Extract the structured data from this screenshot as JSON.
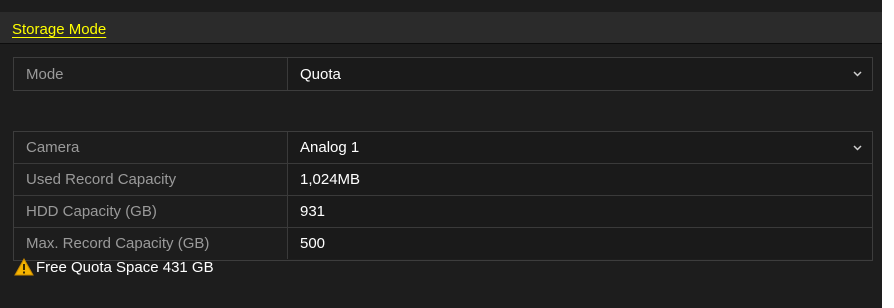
{
  "tab": {
    "label": "Storage Mode"
  },
  "mode": {
    "label": "Mode",
    "value": "Quota"
  },
  "camera_settings": {
    "camera": {
      "label": "Camera",
      "value": "Analog 1"
    },
    "used_record_capacity": {
      "label": "Used Record Capacity",
      "value": "1,024MB"
    },
    "hdd_capacity": {
      "label": "HDD Capacity (GB)",
      "value": "931"
    },
    "max_record_capacity": {
      "label": "Max. Record Capacity (GB)",
      "value": "500"
    }
  },
  "notice": {
    "icon": "warning-icon",
    "text": "Free Quota Space 431 GB"
  },
  "colors": {
    "background": "#1d1d1d",
    "tab_text": "#ffff00",
    "label_text": "#9a9a9a",
    "value_text": "#ffffff",
    "warning": "#f5b400"
  }
}
